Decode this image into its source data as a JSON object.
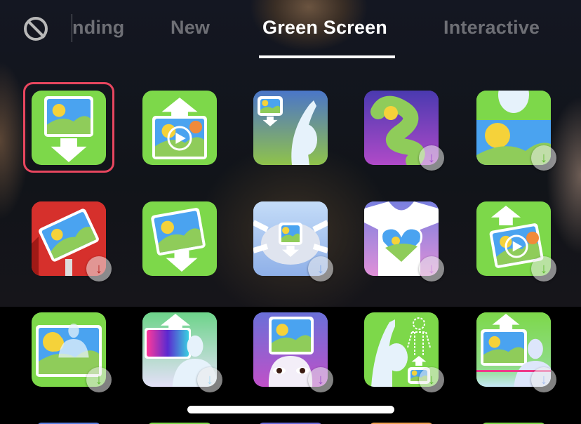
{
  "tabs": {
    "no_effect_icon": "no-entry-icon",
    "items": [
      {
        "label": "nding",
        "full_label": "Trending",
        "active": false
      },
      {
        "label": "New",
        "active": false
      },
      {
        "label": "Green Screen",
        "active": true
      },
      {
        "label": "Interactive",
        "active": false
      }
    ]
  },
  "effects": {
    "selected_index": 0,
    "accent_selected": "#e8465f",
    "rows": [
      [
        {
          "name": "image-background-down",
          "bg": "#7dd84a",
          "downloaded": true
        },
        {
          "name": "video-background-up",
          "bg": "#7dd84a",
          "downloaded": true
        },
        {
          "name": "wave-photo-background",
          "bg": "#4f7fc9",
          "downloaded": true
        },
        {
          "name": "swirl-photo",
          "bg": "#7a3fc0",
          "downloaded": false,
          "badge_color": "#a050d0"
        },
        {
          "name": "shirt-photo",
          "bg": "#7dd84a",
          "downloaded": false,
          "badge_color": "#5cb82e"
        }
      ],
      [
        {
          "name": "billboard-photo",
          "bg": "#d6302c",
          "downloaded": false,
          "badge_color": "#b0201c"
        },
        {
          "name": "tilted-photo-down",
          "bg": "#7dd84a",
          "downloaded": true
        },
        {
          "name": "mask-photo",
          "bg": "#a8c8f0",
          "downloaded": false,
          "badge_color": "#7ea8e8"
        },
        {
          "name": "heart-photo-shirt",
          "bg": "#8a88d8",
          "downloaded": false,
          "badge_color": "#d090e0"
        },
        {
          "name": "tilted-video-up",
          "bg": "#7dd84a",
          "downloaded": false,
          "badge_color": "#5cb82e"
        }
      ],
      [
        {
          "name": "hand-over-photo",
          "bg": "#7dd84a",
          "downloaded": false,
          "badge_color": "#5cb82e"
        },
        {
          "name": "person-over-gradient",
          "bg": "#6dd48a",
          "downloaded": false,
          "badge_color": "#a8d8f0"
        },
        {
          "name": "photo-head-eyes",
          "bg": "#7a6ad8",
          "downloaded": false,
          "badge_color": "#9a50c8"
        },
        {
          "name": "wave-outline-person",
          "bg": "#7dd84a",
          "downloaded": false,
          "badge_color": "#5cb82e"
        },
        {
          "name": "photo-person-line",
          "bg": "#7dd84a",
          "downloaded": false,
          "badge_color": "#a8c0f0"
        }
      ]
    ],
    "peek_row_colors": [
      "#5a80e0",
      "#7dd84a",
      "#6a6ad8",
      "#f0a050",
      "#7dd84a"
    ]
  },
  "download_badge_glyph": "↓"
}
